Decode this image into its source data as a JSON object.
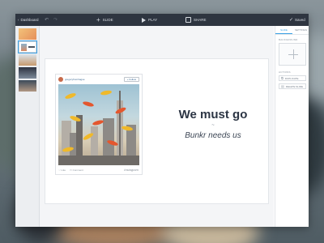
{
  "toolbar": {
    "back_label": "Dashboard",
    "back_icon": "‹",
    "undo_icon": "↶",
    "redo_icon": "↷",
    "slide_label": "SLIDE",
    "play_label": "PLAY",
    "share_label": "SHARE",
    "saved_label": "Saved"
  },
  "slide": {
    "headline": "We must go",
    "dash": "~",
    "subline": "Bunkr needs us",
    "post": {
      "username": "gregoryfromhague",
      "follow_label": "+ Follow",
      "like_label": "♡ Like",
      "comment_label": "▭ Comment",
      "brand": "Instagram"
    }
  },
  "panel": {
    "tabs": [
      "SLIDE",
      "SETTINGS"
    ],
    "background_label": "BACKGROUND",
    "actions_label": "ACTIONS",
    "duplicate_label": "DUPLICATE",
    "delete_label": "DELETE SLIDE"
  },
  "colors": {
    "topbar": "#2e3540",
    "accent": "#3aa0e4",
    "headline": "#2c3544"
  }
}
